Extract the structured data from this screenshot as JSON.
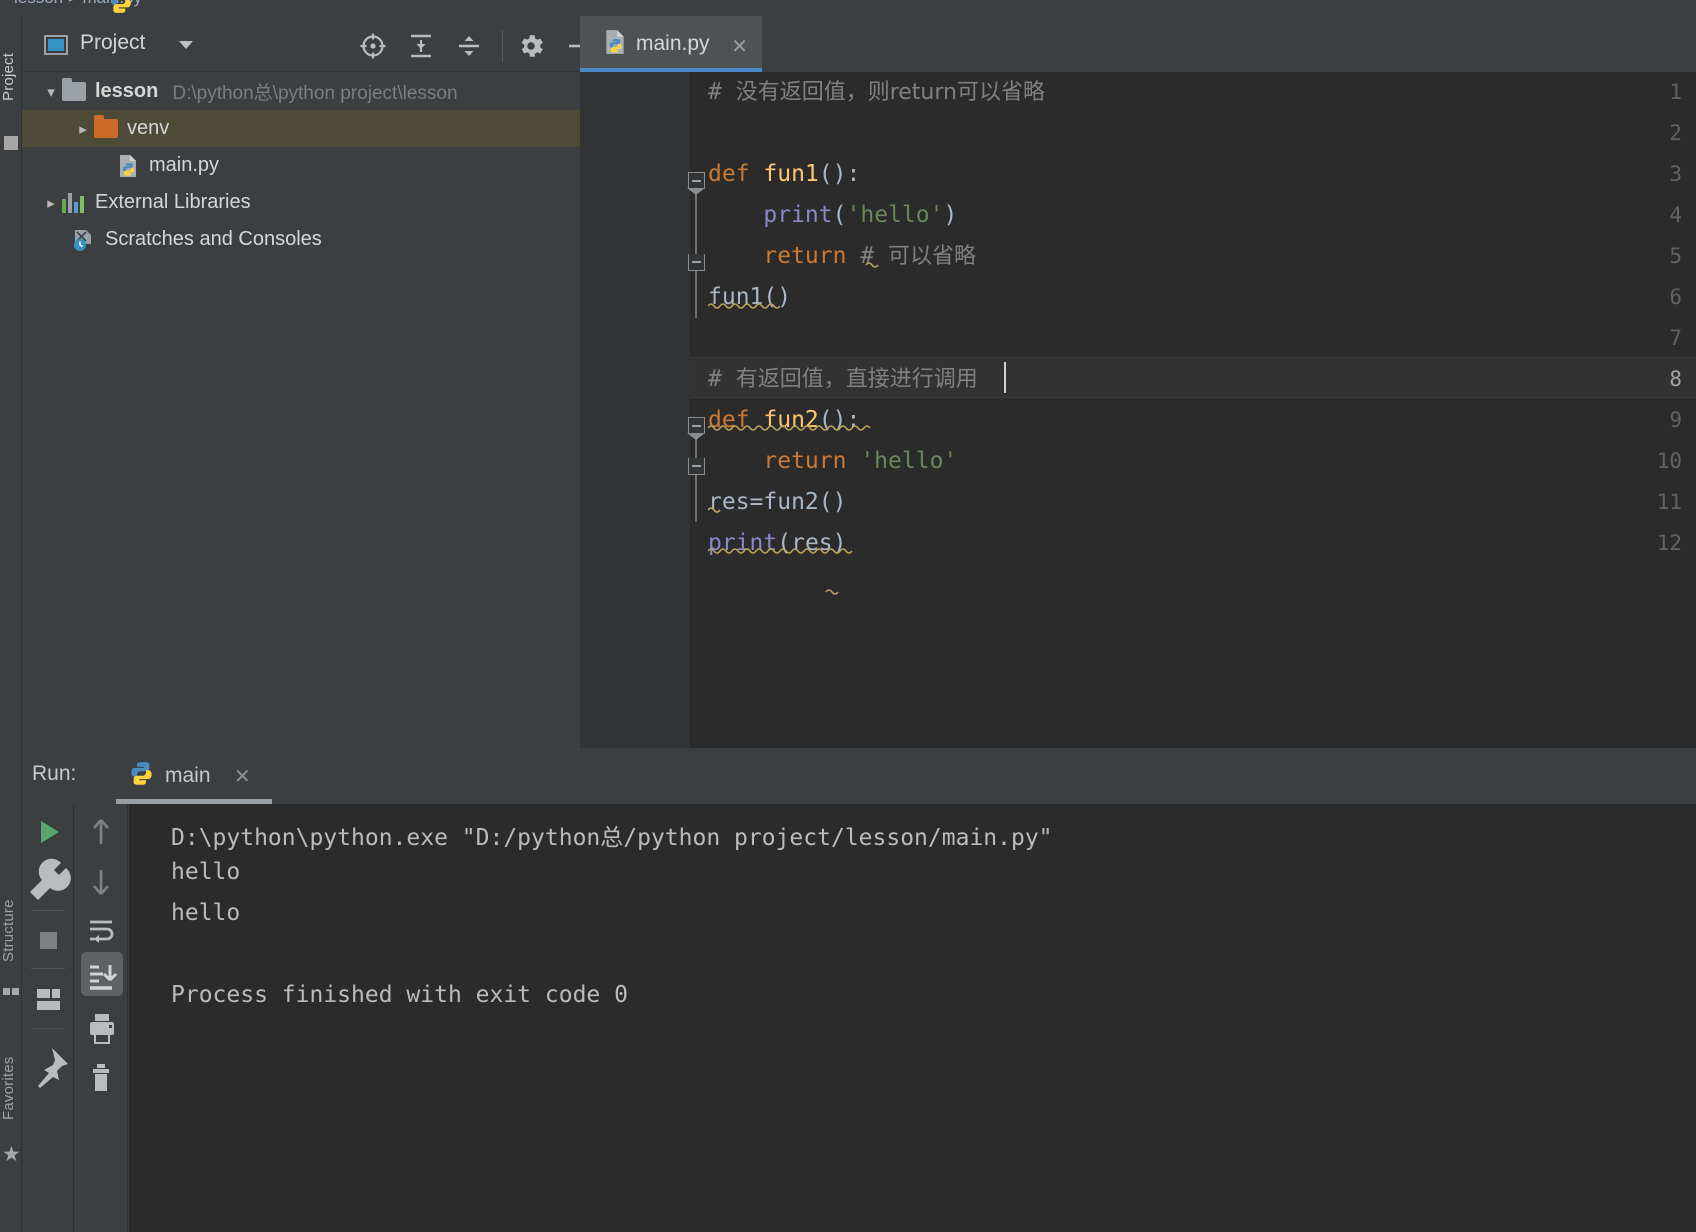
{
  "window": {
    "breadcrumb_cut": "lesson  >  main.py"
  },
  "left_strip": {
    "project_label": "Project",
    "structure_label": "Structure",
    "favorites_label": "Favorites",
    "star_glyph": "★"
  },
  "project_panel": {
    "title": "Project",
    "toolbar": [
      {
        "name": "locate-icon",
        "tooltip": "Select Opened File"
      },
      {
        "name": "expand-all-icon",
        "tooltip": "Expand All"
      },
      {
        "name": "collapse-all-icon",
        "tooltip": "Collapse All"
      },
      {
        "name": "settings-gear-icon",
        "tooltip": "Settings"
      },
      {
        "name": "hide-icon",
        "tooltip": "Hide"
      }
    ],
    "tree": [
      {
        "label": "lesson",
        "path": "D:\\python总\\python project\\lesson",
        "icon": "folder-gray",
        "arrow": "down",
        "selected": false,
        "indent": 0
      },
      {
        "label": "venv",
        "path": "",
        "icon": "folder-orange",
        "arrow": "right",
        "selected": true,
        "indent": 1
      },
      {
        "label": "main.py",
        "path": "",
        "icon": "python-file",
        "arrow": "none",
        "selected": false,
        "indent": 2
      },
      {
        "label": "External Libraries",
        "path": "",
        "icon": "libraries",
        "arrow": "right",
        "selected": false,
        "indent": 0
      },
      {
        "label": "Scratches and Consoles",
        "path": "",
        "icon": "scratches",
        "arrow": "none",
        "selected": false,
        "indent": 1
      }
    ]
  },
  "editor": {
    "tab": {
      "name": "main.py",
      "icon": "python-file-icon",
      "close_glyph": "✕",
      "active": true
    },
    "current_line": 8,
    "lines": [
      {
        "n": 1,
        "segments": [
          {
            "t": "# ",
            "c": "cm"
          },
          {
            "t": "没有返回值，则return可以省略",
            "c": "cmcn"
          }
        ]
      },
      {
        "n": 2,
        "segments": []
      },
      {
        "n": 3,
        "segments": [
          {
            "t": "def ",
            "c": "kw"
          },
          {
            "t": "fun1",
            "c": "fn"
          },
          {
            "t": "():",
            "c": "pl"
          }
        ]
      },
      {
        "n": 4,
        "segments": [
          {
            "t": "    ",
            "c": "pl"
          },
          {
            "t": "print",
            "c": "bi"
          },
          {
            "t": "(",
            "c": "pl"
          },
          {
            "t": "'hello'",
            "c": "str"
          },
          {
            "t": ")",
            "c": "pl"
          }
        ]
      },
      {
        "n": 5,
        "segments": [
          {
            "t": "    ",
            "c": "pl"
          },
          {
            "t": "return ",
            "c": "kw"
          },
          {
            "t": "# ",
            "c": "cm"
          },
          {
            "t": "可以省略",
            "c": "cmcn"
          }
        ]
      },
      {
        "n": 6,
        "segments": [
          {
            "t": "fun1()",
            "c": "pl"
          }
        ]
      },
      {
        "n": 7,
        "segments": []
      },
      {
        "n": 8,
        "segments": [
          {
            "t": "# ",
            "c": "cm"
          },
          {
            "t": "有返回值，直接进行调用",
            "c": "cmcn"
          }
        ]
      },
      {
        "n": 9,
        "segments": [
          {
            "t": "def ",
            "c": "kw"
          },
          {
            "t": "fun2",
            "c": "fn"
          },
          {
            "t": "():",
            "c": "pl"
          }
        ]
      },
      {
        "n": 10,
        "segments": [
          {
            "t": "    ",
            "c": "pl"
          },
          {
            "t": "return ",
            "c": "kw"
          },
          {
            "t": "'hello'",
            "c": "str"
          }
        ]
      },
      {
        "n": 11,
        "segments": [
          {
            "t": "res=fun2()",
            "c": "pl"
          }
        ]
      },
      {
        "n": 12,
        "segments": [
          {
            "t": "print",
            "c": "bi"
          },
          {
            "t": "(res)",
            "c": "pl"
          }
        ]
      }
    ]
  },
  "run_panel": {
    "label": "Run:",
    "tab_name": "main",
    "tab_close_glyph": "✕",
    "toolbar_left": [
      {
        "name": "run-icon"
      },
      {
        "name": "wrench-icon"
      },
      {
        "name": "stop-icon"
      },
      {
        "name": "layout-icon"
      },
      {
        "name": "pin-icon"
      }
    ],
    "toolbar_right": [
      {
        "name": "arrow-up-icon"
      },
      {
        "name": "arrow-down-icon"
      },
      {
        "name": "soft-wrap-icon"
      },
      {
        "name": "scroll-to-end-icon",
        "active": true
      },
      {
        "name": "print-icon"
      },
      {
        "name": "trash-icon"
      }
    ],
    "console_lines": [
      "D:\\python\\python.exe \"D:/python总/python project/lesson/main.py\"",
      "hello",
      "hello",
      "",
      "Process finished with exit code 0"
    ]
  },
  "colors": {
    "editor_bg": "#2b2b2b",
    "panel_bg": "#3c3f41",
    "gutter_bg": "#313335",
    "keyword": "#cc7832",
    "function": "#ffc66d",
    "string": "#6a8759",
    "builtin": "#8888c6",
    "comment": "#808080",
    "plain": "#a9b7c6",
    "tab_underline": "#4a88c7",
    "selection": "#4e4a38",
    "run_green": "#59a869"
  }
}
